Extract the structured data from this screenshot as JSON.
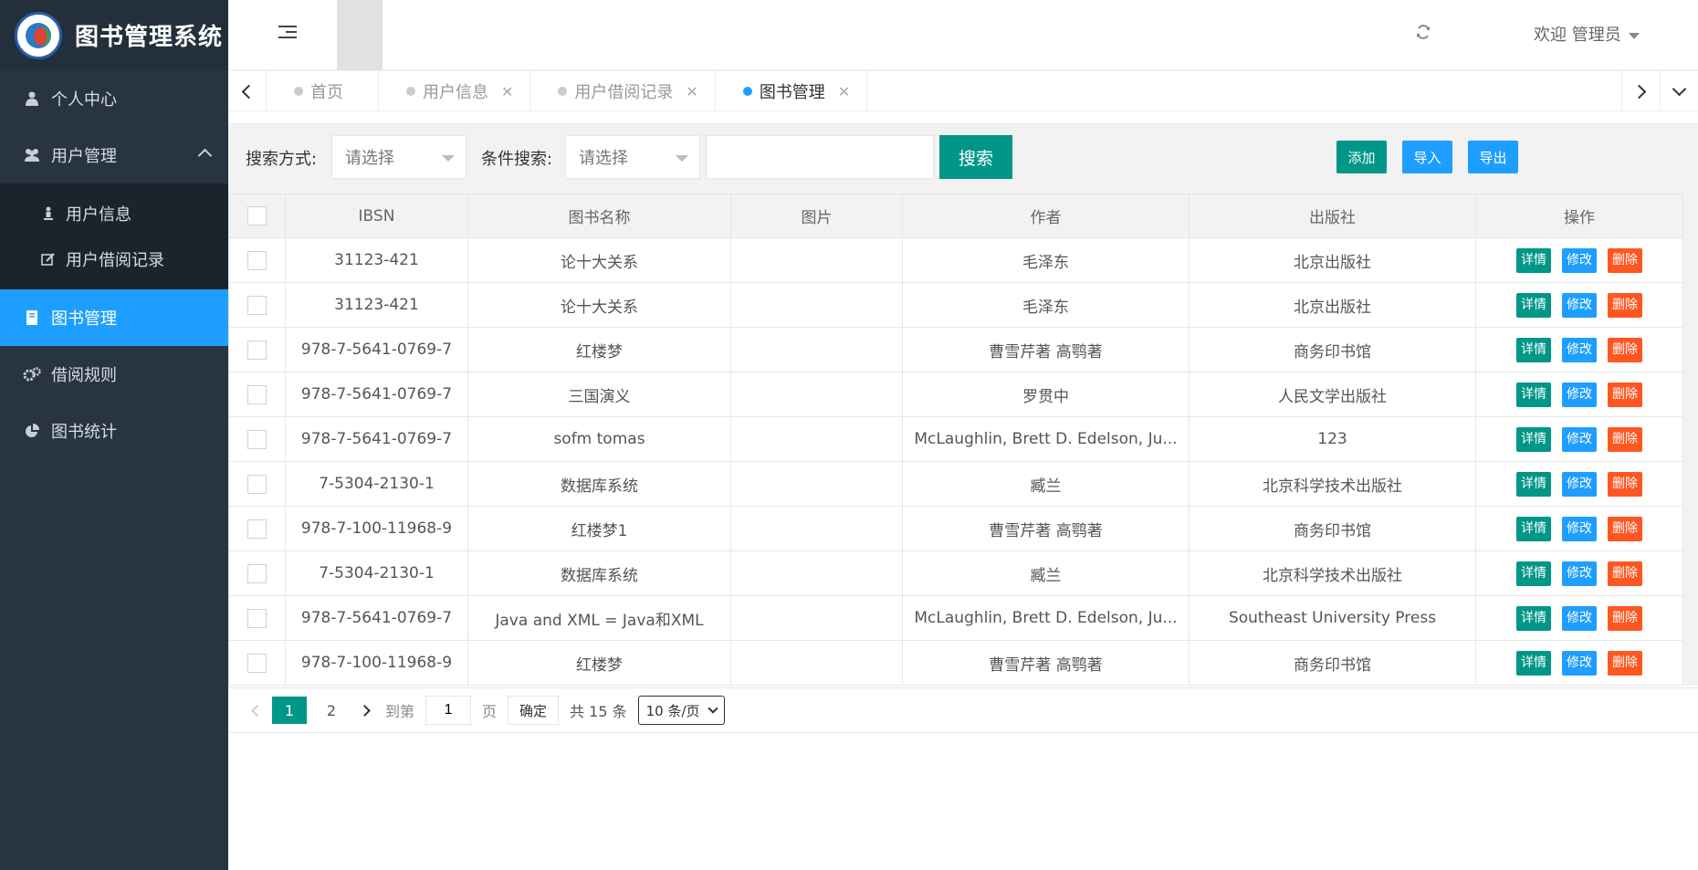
{
  "app": {
    "title": "图书管理系统"
  },
  "sidebar": {
    "items": [
      {
        "label": "个人中心",
        "icon": "user-icon"
      },
      {
        "label": "用户管理",
        "icon": "users-icon",
        "expanded": true,
        "children": [
          {
            "label": "用户信息",
            "icon": "person-icon"
          },
          {
            "label": "用户借阅记录",
            "icon": "edit-icon"
          }
        ]
      },
      {
        "label": "图书管理",
        "icon": "book-icon",
        "active": true
      },
      {
        "label": "借阅规则",
        "icon": "gears-icon"
      },
      {
        "label": "图书统计",
        "icon": "pie-chart-icon"
      }
    ]
  },
  "header": {
    "welcome": "欢迎 管理员"
  },
  "tabs": [
    {
      "label": "首页",
      "closable": false
    },
    {
      "label": "用户信息",
      "closable": true
    },
    {
      "label": "用户借阅记录",
      "closable": true
    },
    {
      "label": "图书管理",
      "closable": true,
      "active": true
    }
  ],
  "toolbar": {
    "search_mode_label": "搜索方式:",
    "search_mode_placeholder": "请选择",
    "condition_label": "条件搜索:",
    "condition_placeholder": "请选择",
    "keyword_value": "",
    "search_button": "搜索",
    "add_button": "添加",
    "import_button": "导入",
    "export_button": "导出"
  },
  "table": {
    "columns": [
      "IBSN",
      "图书名称",
      "图片",
      "作者",
      "出版社",
      "操作"
    ],
    "actions": {
      "detail": "详情",
      "edit": "修改",
      "delete": "删除"
    },
    "rows": [
      [
        "31123-421",
        "论十大关系",
        "",
        "毛泽东",
        "北京出版社"
      ],
      [
        "31123-421",
        "论十大关系",
        "",
        "毛泽东",
        "北京出版社"
      ],
      [
        "978-7-5641-0769-7",
        "红楼梦",
        "",
        "曹雪芹著 高鹗著",
        "商务印书馆"
      ],
      [
        "978-7-5641-0769-7",
        "三国演义",
        "",
        "罗贯中",
        "人民文学出版社"
      ],
      [
        "978-7-5641-0769-7",
        "sofm tomas",
        "",
        "McLaughlin, Brett D. Edelson, Ju...",
        "123"
      ],
      [
        "7-5304-2130-1",
        "数据库系统",
        "",
        "臧兰",
        "北京科学技术出版社"
      ],
      [
        "978-7-100-11968-9",
        "红楼梦1",
        "",
        "曹雪芹著 高鹗著",
        "商务印书馆"
      ],
      [
        "7-5304-2130-1",
        "数据库系统",
        "",
        "臧兰",
        "北京科学技术出版社"
      ],
      [
        "978-7-5641-0769-7",
        "Java and XML = Java和XML",
        "",
        "McLaughlin, Brett D. Edelson, Ju...",
        "Southeast University Press"
      ],
      [
        "978-7-100-11968-9",
        "红楼梦",
        "",
        "曹雪芹著 高鹗著",
        "商务印书馆"
      ]
    ]
  },
  "pagination": {
    "pages": [
      "1",
      "2"
    ],
    "current": "1",
    "goto_label": "到第",
    "goto_value": "1",
    "page_suffix": "页",
    "confirm": "确定",
    "total": "共 15 条",
    "page_size": "10 条/页"
  },
  "colors": {
    "sidebar_bg": "#283541",
    "accent_blue": "#1e9fff",
    "primary_green": "#009688",
    "danger_orange": "#ff5722"
  }
}
